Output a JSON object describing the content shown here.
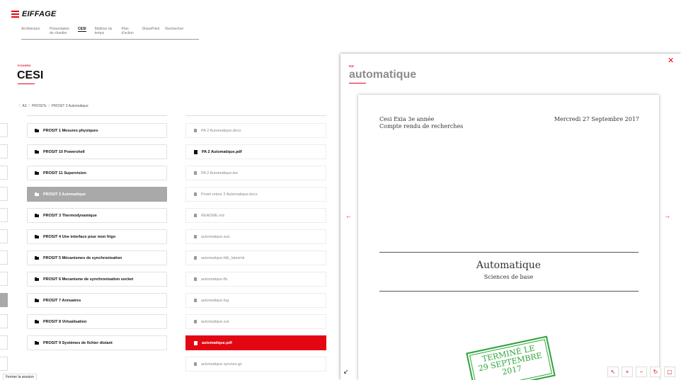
{
  "brand": {
    "name": "EIFFAGE",
    "accent": "#e30613"
  },
  "nav": {
    "items": [
      {
        "label": "Architecture"
      },
      {
        "label": "Présentation de chantier"
      },
      {
        "label": "CESI",
        "active": true
      },
      {
        "label": "Maîtrise du temps"
      },
      {
        "label": "Plan d'action"
      },
      {
        "label": "SharePoint"
      },
      {
        "label": "Rechercher"
      }
    ]
  },
  "section": {
    "kicker": "FICHIERS",
    "title": "CESI"
  },
  "breadcrumb": {
    "sep": "/",
    "items": [
      "A3",
      "PROSITs",
      "PROSIT 2 Automatique"
    ]
  },
  "folders": {
    "selected": 3,
    "items": [
      {
        "label": "PROSIT 1 Mesures physiques"
      },
      {
        "label": "PROSIT 10 Powershell"
      },
      {
        "label": "PROSIT 11 Supervision"
      },
      {
        "label": "PROSIT 2 Automatique"
      },
      {
        "label": "PROSIT 3 Thermodynamique"
      },
      {
        "label": "PROSIT 4 Une interface pour mon frigo"
      },
      {
        "label": "PROSIT 5 Mécanismes de synchronisation"
      },
      {
        "label": "PROSIT 6 Mecanisme de synchronisation socket"
      },
      {
        "label": "PROSIT 7 Annuaires"
      },
      {
        "label": "PROSIT 8 Virtualisation"
      },
      {
        "label": "PROSIT 9 Systèmes de fichier distant"
      }
    ]
  },
  "files": {
    "selected": 10,
    "items": [
      {
        "label": "PA 2 Automatique.docx",
        "style": "muted",
        "icon": "file-icon"
      },
      {
        "label": "PA 2 Automatique.pdf",
        "style": "dark",
        "icon": "pdf-icon"
      },
      {
        "label": "PA 2 Automatique.tex",
        "style": "muted",
        "icon": "file-icon"
      },
      {
        "label": "Prosit retour 2 Automatique.docx",
        "style": "muted",
        "icon": "file-icon"
      },
      {
        "label": "README.md",
        "style": "muted",
        "icon": "file-icon"
      },
      {
        "label": "automatique.aux",
        "style": "muted",
        "icon": "file-icon"
      },
      {
        "label": "automatique.fdb_latexmk",
        "style": "muted",
        "icon": "file-icon"
      },
      {
        "label": "automatique.fls",
        "style": "muted",
        "icon": "file-icon"
      },
      {
        "label": "automatique.log",
        "style": "muted",
        "icon": "file-icon"
      },
      {
        "label": "automatique.out",
        "style": "muted",
        "icon": "file-icon"
      },
      {
        "label": "automatique.pdf",
        "style": "active",
        "icon": "pdf-icon"
      },
      {
        "label": "automatique.synctex.gz",
        "style": "muted",
        "icon": "file-icon"
      }
    ]
  },
  "viewer": {
    "kicker": "PDF",
    "title": "automatique",
    "close_icon": "close-icon",
    "prev_icon": "arrow-left-icon",
    "next_icon": "arrow-right-icon",
    "collapse_icon": "collapse-icon",
    "toolbar_icons": [
      "expand-icon",
      "zoom-in-icon",
      "zoom-out-icon",
      "rotate-icon",
      "fit-icon"
    ]
  },
  "document": {
    "header_line1": "Cesi Exia 3e année",
    "header_line2": "Compte rendu de recherches",
    "date": "Mercredi 27 Septembre 2017",
    "title": "Automatique",
    "subtitle": "Sciences de base",
    "stamp_line1": "TERMINÉ LE",
    "stamp_line2": "29 SEPTEMBRE",
    "stamp_line3": "2017",
    "stamp_color": "#2ea43a"
  },
  "footer": {
    "logout_label": "Fermer la session"
  }
}
